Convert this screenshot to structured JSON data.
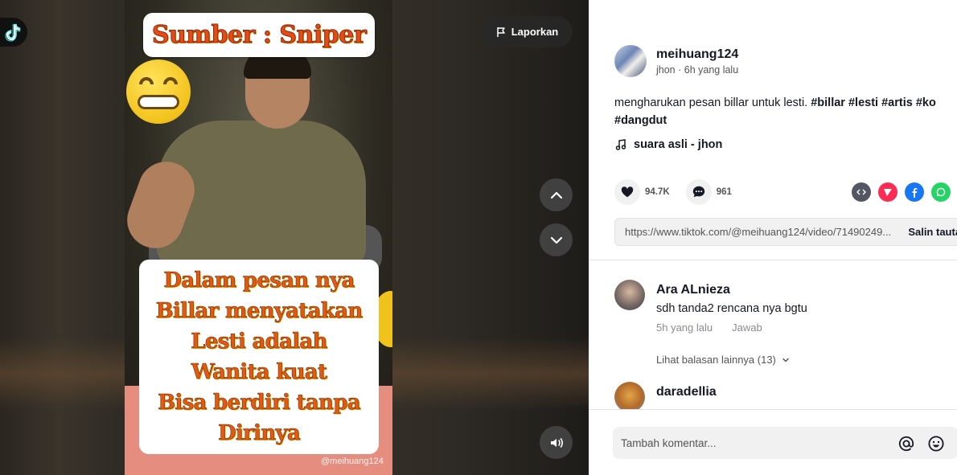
{
  "video": {
    "source_text": "Sumber : Sniper",
    "caption_lines": [
      "Dalam pesan nya",
      "Billar menyatakan",
      "Lesti adalah",
      "Wanita kuat",
      "Bisa berdiri tanpa",
      "Dirinya"
    ],
    "watermark": "TikTok",
    "watermark_handle": "@meihuang124",
    "report_label": "Laporkan"
  },
  "post": {
    "username": "meihuang124",
    "subline": "jhon · 6h yang lalu",
    "description_text": "mengharukan pesan billar untuk lesti.",
    "hashtags": [
      "#billar",
      "#lesti",
      "#artis",
      "#ko"
    ],
    "hashtag_line2": "#dangdut",
    "music": "suara asli - jhon",
    "likes": "94.7K",
    "comments_count": "961",
    "link_url": "https://www.tiktok.com/@meihuang124/video/71490249...",
    "copy_label": "Salin tautan"
  },
  "comments": [
    {
      "name": "Ara ALnieza",
      "text": "sdh tanda2 rencana nya bgtu",
      "time": "5h yang lalu",
      "reply": "Jawab"
    },
    {
      "name": "daradellia"
    }
  ],
  "more_replies": "Lihat balasan lainnya (13)",
  "comment_input": {
    "placeholder": "Tambah komentar..."
  },
  "colors": {
    "share_embed": "#545763",
    "share_send": "#fe2c55",
    "share_facebook": "#1877f2",
    "share_whatsapp": "#25d366"
  }
}
